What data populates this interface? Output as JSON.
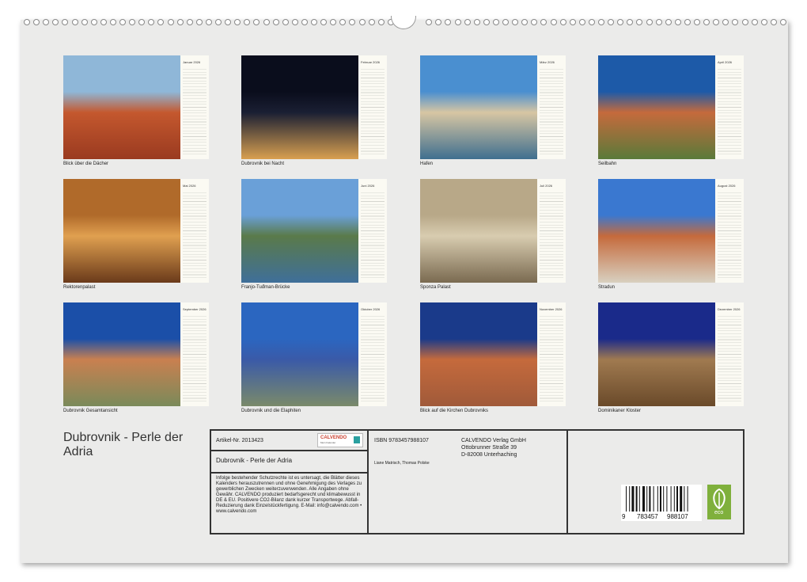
{
  "months": [
    {
      "name": "Januar 2026",
      "caption": "Blick über die Dächer",
      "colors": [
        "#8fb7d8",
        "#c4582e",
        "#9a3a20"
      ]
    },
    {
      "name": "Februar 2026",
      "caption": "Dubrovnik bei Nacht",
      "colors": [
        "#0a0d1c",
        "#1a1f33",
        "#d9a050"
      ]
    },
    {
      "name": "März 2026",
      "caption": "Hafen",
      "colors": [
        "#4a8fd0",
        "#d7c6a3",
        "#3f6f8f"
      ]
    },
    {
      "name": "April 2026",
      "caption": "Seilbahn",
      "colors": [
        "#1d5aa8",
        "#c56a3c",
        "#5a7a3a"
      ]
    },
    {
      "name": "Mai 2026",
      "caption": "Rektorenpalast",
      "colors": [
        "#b06a2a",
        "#e0a050",
        "#6a3a1a"
      ]
    },
    {
      "name": "Juni 2026",
      "caption": "Franjo-Tuđman-Brücke",
      "colors": [
        "#6aa0d8",
        "#5a7a4a",
        "#3f6f9a"
      ]
    },
    {
      "name": "Juli 2026",
      "caption": "Sponza Palast",
      "colors": [
        "#b8a888",
        "#d8ccb0",
        "#7a6a50"
      ]
    },
    {
      "name": "August 2026",
      "caption": "Stradun",
      "colors": [
        "#3a78d0",
        "#c56a3c",
        "#d8d0c0"
      ]
    },
    {
      "name": "September 2026",
      "caption": "Dubrovnik Gesamtansicht",
      "colors": [
        "#1b4fa8",
        "#c98050",
        "#7a8a5a"
      ]
    },
    {
      "name": "Oktober 2026",
      "caption": "Dubrovnik und die Elaphiten",
      "colors": [
        "#2b66c0",
        "#3a5aa8",
        "#7a8a6a"
      ]
    },
    {
      "name": "November 2026",
      "caption": "Blick auf die Kirchen Dubrovniks",
      "colors": [
        "#1a3a8a",
        "#c56a3c",
        "#a05a3a"
      ]
    },
    {
      "name": "Dezember 2026",
      "caption": "Dominikaner Kloster",
      "colors": [
        "#1a2a8a",
        "#a07a50",
        "#6a4a2a"
      ]
    }
  ],
  "title": "Dubrovnik - Perle der Adria",
  "info": {
    "article": "Artikel-Nr. 2013423",
    "logo": "CALVENDO",
    "logo_sub": "Mein Kalender",
    "book_title": "Dubrovnik - Perle der Adria",
    "legal": "Infolge bestehender Schutzrechte ist es untersagt, die Blätter dieses Kalenders herauszutrennen und ohne Genehmigung des Verlages zu gewerblichen Zwecken weiterzuverwenden. Alle Angaben ohne Gewähr. CALVENDO produziert bedarfsgerecht und klimabewusst in DE & EU. Positivere CO2-Bilanz dank kurzer Transportwege. Abfall-Reduzierung dank Einzelstückfertigung. E-Mail: info@calvendo.com • www.calvendo.com",
    "isbn": "ISBN 9783457988107",
    "authors": "Liane Matrisch, Thomas Polske",
    "publisher": [
      "CALVENDO Verlag GmbH",
      "Ottobrunner Straße 39",
      "D-82008 Unterhaching"
    ],
    "barcode_digits": [
      "9",
      "783457",
      "988107"
    ],
    "eco": "eco"
  }
}
